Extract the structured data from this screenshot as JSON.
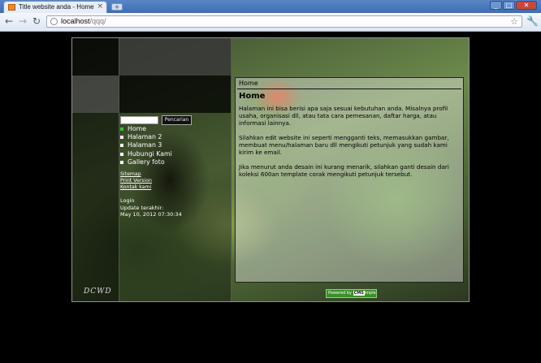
{
  "browser": {
    "tab_title": "Title website anda - Home",
    "tab_close": "×",
    "new_tab": "+",
    "url_host": "localhost",
    "url_path": "/qqq/",
    "back": "←",
    "forward": "→",
    "reload": "↻",
    "star": "☆",
    "wrench": "🔧",
    "minimize": "_",
    "maximize": "□",
    "close": "✕"
  },
  "site": {
    "breadcrumb": "Home",
    "title": "Home",
    "paragraphs": [
      "Halaman ini bisa berisi apa saja sesuai kebutuhan anda. Misalnya profil usaha, organisasi dll, atau tata cara pemesanan, daftar harga, atau informasi lainnya.",
      "Silahkan edit website ini seperti mengganti teks, memasukkan gambar, membuat menu/halaman baru dll mengikuti petunjuk yang sudah kami kirim ke email.",
      "Jika menurut anda desain ini kurang menarik, silahkan ganti desain dari koleksi 600an template corak mengikuti petunjuk tersebut."
    ],
    "search_button": "Pencarian",
    "menu": [
      "Home",
      "Halaman 2",
      "Halaman 3",
      "Hubungi Kami",
      "Gallery foto"
    ],
    "links": [
      "Sitemap",
      "Print Version",
      "Kontak kami"
    ],
    "login": "Login",
    "update_label": "Update terakhir:",
    "update_value": "May 10, 2012 07:30:34",
    "logo": "DCWD",
    "badge_powered": "Powered by",
    "badge_cms": "CMS",
    "badge_simple": "imple"
  },
  "colors": {
    "accent_active": "#3fbf3a",
    "titlebar": "#3e6db3",
    "page_background": "#000000"
  }
}
